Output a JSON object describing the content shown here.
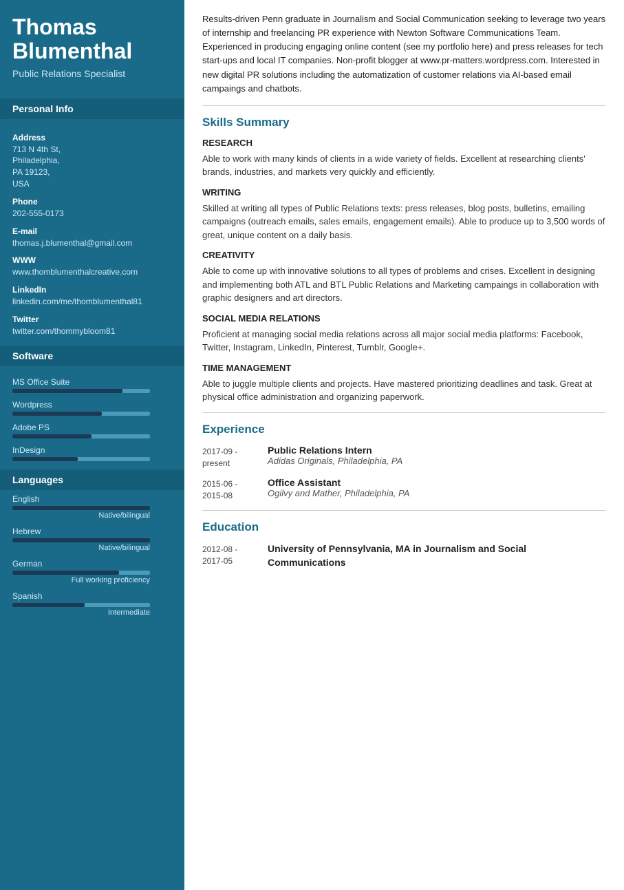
{
  "sidebar": {
    "name": "Thomas Blumenthal",
    "title": "Public Relations Specialist",
    "personal_info_label": "Personal Info",
    "address_label": "Address",
    "address": "713 N 4th St,\nPhiladelphia,\nPA 19123,\nUSA",
    "phone_label": "Phone",
    "phone": "202-555-0173",
    "email_label": "E-mail",
    "email": "thomas.j.blumenthal@gmail.com",
    "www_label": "WWW",
    "www": "www.thomblumenthalcreative.com",
    "linkedin_label": "LinkedIn",
    "linkedin": "linkedin.com/me/thomblumenthal81",
    "twitter_label": "Twitter",
    "twitter": "twitter.com/thommybloom81",
    "software_label": "Software",
    "software": [
      {
        "name": "MS Office Suite",
        "fill": 160
      },
      {
        "name": "Wordpress",
        "fill": 130
      },
      {
        "name": "Adobe PS",
        "fill": 115
      },
      {
        "name": "InDesign",
        "fill": 95
      }
    ],
    "languages_label": "Languages",
    "languages": [
      {
        "name": "English",
        "fill": 200,
        "level": "Native/bilingual"
      },
      {
        "name": "Hebrew",
        "fill": 200,
        "level": "Native/bilingual"
      },
      {
        "name": "German",
        "fill": 155,
        "level": "Full working proficiency"
      },
      {
        "name": "Spanish",
        "fill": 105,
        "level": "Intermediate"
      }
    ]
  },
  "main": {
    "summary": "Results-driven Penn graduate in Journalism and Social Communication seeking to leverage two years of internship and freelancing PR experience with Newton Software Communications Team. Experienced in producing engaging online content (see my portfolio here) and press releases for tech start-ups and local IT companies. Non-profit blogger at www.pr-matters.wordpress.com. Interested in new digital PR solutions including the automatization of customer relations via AI-based email campaings and chatbots.",
    "skills_label": "Skills Summary",
    "skills": [
      {
        "heading": "RESEARCH",
        "desc": "Able to work with many kinds of clients in a wide variety of fields. Excellent at researching clients' brands, industries, and markets very quickly and efficiently."
      },
      {
        "heading": "WRITING",
        "desc": "Skilled at writing all types of Public Relations texts: press releases, blog posts, bulletins, emailing campaigns (outreach emails, sales emails, engagement emails). Able to produce up to 3,500 words of great, unique content on a daily basis."
      },
      {
        "heading": "CREATIVITY",
        "desc": "Able to come up with innovative solutions to all types of problems and crises. Excellent in designing and implementing both ATL and BTL Public Relations and Marketing campaings in collaboration with graphic designers and art directors."
      },
      {
        "heading": "SOCIAL MEDIA RELATIONS",
        "desc": "Proficient at managing social media relations across all major social media platforms: Facebook, Twitter, Instagram, LinkedIn, Pinterest, Tumblr, Google+."
      },
      {
        "heading": "TIME MANAGEMENT",
        "desc": "Able to juggle multiple clients and projects. Have mastered prioritizing deadlines and task. Great at physical office administration and organizing paperwork."
      }
    ],
    "experience_label": "Experience",
    "experience": [
      {
        "date": "2017-09 -\npresent",
        "title": "Public Relations Intern",
        "company": "Adidas Originals, Philadelphia, PA"
      },
      {
        "date": "2015-06 -\n2015-08",
        "title": "Office Assistant",
        "company": "Ogilvy and Mather, Philadelphia, PA"
      }
    ],
    "education_label": "Education",
    "education": [
      {
        "date": "2012-08 -\n2017-05",
        "title": "University of Pennsylvania, MA in Journalism and Social Communications"
      }
    ]
  }
}
